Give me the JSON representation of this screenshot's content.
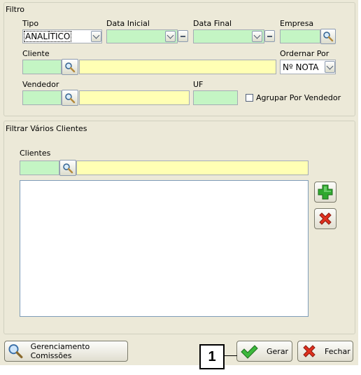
{
  "filtro": {
    "title": "Filtro",
    "tipo": {
      "label": "Tipo",
      "value": "ANALÍTICO"
    },
    "data_inicial": {
      "label": "Data Inicial"
    },
    "data_final": {
      "label": "Data Final"
    },
    "empresa": {
      "label": "Empresa"
    },
    "cliente": {
      "label": "Cliente"
    },
    "ordernar_por": {
      "label": "Ordernar Por",
      "value": "Nº NOTA"
    },
    "vendedor": {
      "label": "Vendedor"
    },
    "uf": {
      "label": "UF"
    },
    "agrupar": {
      "label": "Agrupar Por Vendedor",
      "checked": false
    }
  },
  "filtrar_varios": {
    "title": "Filtrar Vários Clientes",
    "clientes_label": "Clientes"
  },
  "footer": {
    "gerenciamento_label": "Gerenciamento Comissões",
    "gerar_label": "Gerar",
    "fechar_label": "Fechar",
    "callout_number": "1"
  },
  "colors": {
    "window_bg": "#ece9d8",
    "field_green": "#c4f5c4",
    "field_yellow": "#ffffb4",
    "add_green": "#2fa82f",
    "remove_red": "#e0301e"
  },
  "icons": [
    "search-icon",
    "chevron-down-icon",
    "minus-icon",
    "plus-icon",
    "x-icon",
    "check-icon",
    "close-icon"
  ]
}
